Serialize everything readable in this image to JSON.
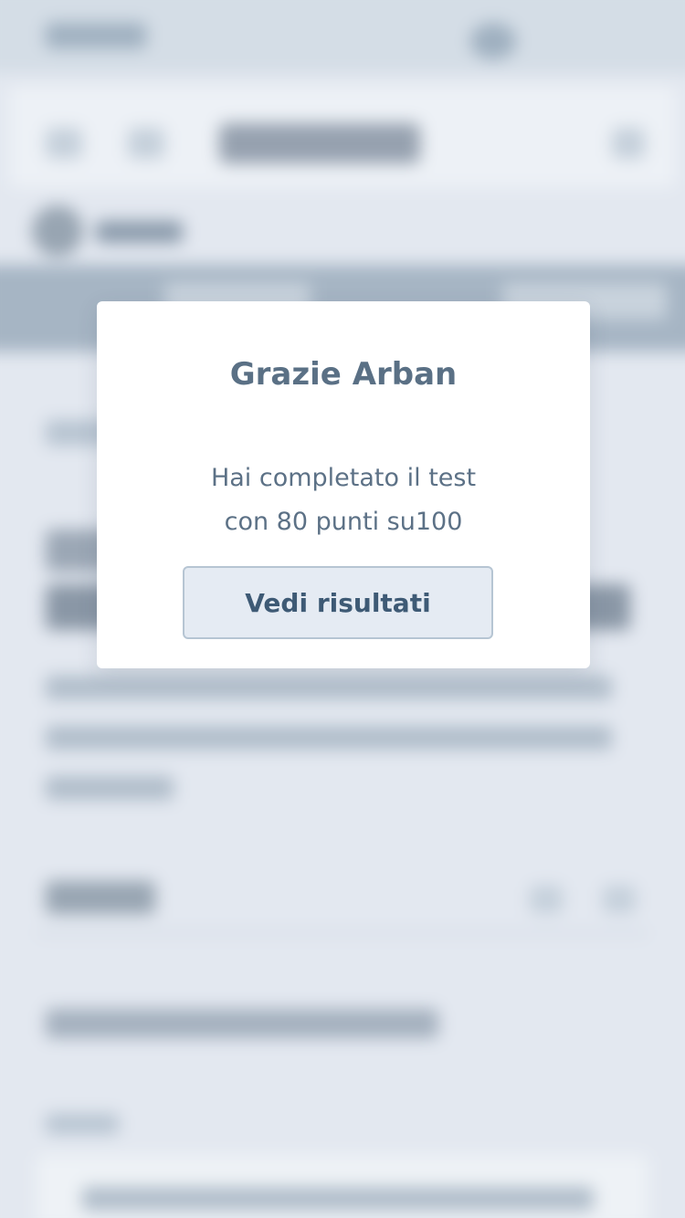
{
  "modal": {
    "title": "Grazie Arban",
    "message_line1": "Hai completato il test",
    "message_line2": "con 80 punti su100",
    "button_label": "Vedi risultati"
  },
  "colors": {
    "modal_background": "#ffffff",
    "text": "#5c7186",
    "button_background": "#e5ebf3",
    "button_border": "#b6c5d3",
    "button_text": "#3e5a75",
    "page_background": "#e3e8f0"
  }
}
